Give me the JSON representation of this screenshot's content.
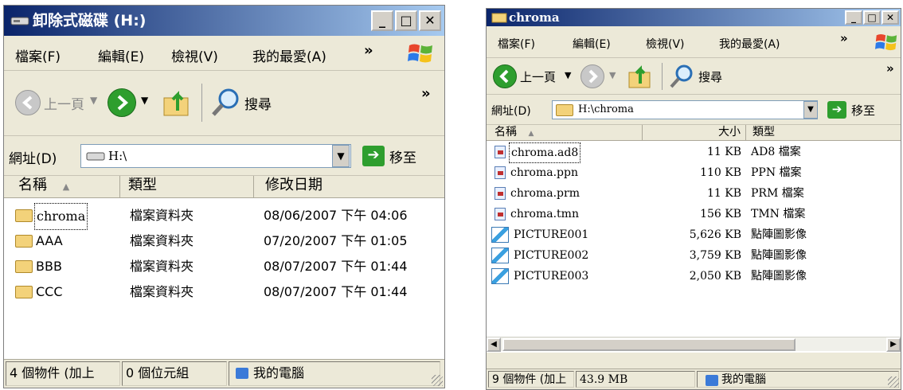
{
  "win1": {
    "title": "卸除式磁碟 (H:)",
    "buttons": {
      "minimize": "_",
      "maximize": "□",
      "close": "✕"
    },
    "menu": [
      "檔案(F)",
      "編輯(E)",
      "檢視(V)",
      "我的最愛(A)"
    ],
    "menu_more": "»",
    "toolbar": {
      "back": "上一頁",
      "search": "搜尋",
      "more": "»"
    },
    "address": {
      "label": "網址(D)",
      "value": "H:\\",
      "go": "移至"
    },
    "columns": [
      "名稱",
      "類型",
      "修改日期"
    ],
    "rows": [
      {
        "name": "chroma",
        "type": "檔案資料夾",
        "date": "08/06/2007 下午 04:06"
      },
      {
        "name": "AAA",
        "type": "檔案資料夾",
        "date": "07/20/2007 下午 01:05"
      },
      {
        "name": "BBB",
        "type": "檔案資料夾",
        "date": "08/07/2007 下午 01:44"
      },
      {
        "name": "CCC",
        "type": "檔案資料夾",
        "date": "08/07/2007 下午 01:44"
      }
    ],
    "status": {
      "count": "4 個物件 (加上",
      "size": "0 個位元組",
      "location": "我的電腦"
    }
  },
  "win2": {
    "title": "chroma",
    "buttons": {
      "minimize": "_",
      "maximize": "□",
      "close": "✕"
    },
    "menu": [
      "檔案(F)",
      "編輯(E)",
      "檢視(V)",
      "我的最愛(A)"
    ],
    "menu_more": "»",
    "toolbar": {
      "back": "上一頁",
      "search": "搜尋",
      "more": "»"
    },
    "address": {
      "label": "網址(D)",
      "value": "H:\\chroma",
      "go": "移至"
    },
    "columns": [
      "名稱",
      "大小",
      "類型"
    ],
    "rows": [
      {
        "name": "chroma.ad8",
        "size": "11 KB",
        "type": "AD8 檔案",
        "icon": "file-icon"
      },
      {
        "name": "chroma.ppn",
        "size": "110 KB",
        "type": "PPN 檔案",
        "icon": "file-icon"
      },
      {
        "name": "chroma.prm",
        "size": "11 KB",
        "type": "PRM 檔案",
        "icon": "file-icon"
      },
      {
        "name": "chroma.tmn",
        "size": "156 KB",
        "type": "TMN 檔案",
        "icon": "file-icon"
      },
      {
        "name": "PICTURE001",
        "size": "5,626 KB",
        "type": "點陣圖影像",
        "icon": "bitmap-icon"
      },
      {
        "name": "PICTURE002",
        "size": "3,759 KB",
        "type": "點陣圖影像",
        "icon": "bitmap-icon"
      },
      {
        "name": "PICTURE003",
        "size": "2,050 KB",
        "type": "點陣圖影像",
        "icon": "bitmap-icon"
      }
    ],
    "status": {
      "count": "9 個物件 (加上",
      "size": "43.9 MB",
      "location": "我的電腦"
    }
  }
}
